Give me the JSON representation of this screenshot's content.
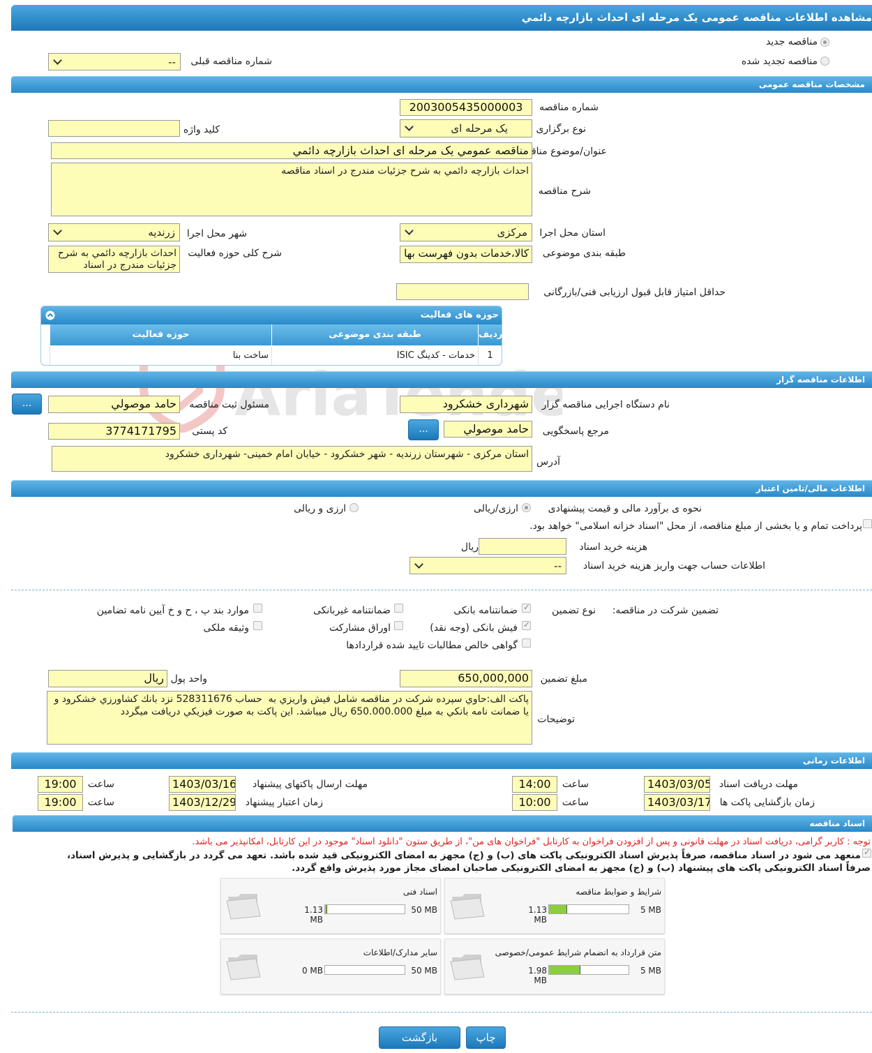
{
  "title": "مشاهده اطلاعات مناقصه عمومی یک مرحله ای احداث بازارچه دائمي",
  "radios": {
    "new": "مناقصه جدید",
    "renewed": "مناقصه تجدید شده",
    "prev_label": "شماره مناقصه قبلی",
    "prev_value": "--"
  },
  "sections": {
    "general": "مشخصات مناقصه عمومی",
    "organizer": "اطلاعات مناقصه گزار",
    "finance": "اطلاعات مالی/تامین اعتبار",
    "time": "اطلاعات زمانی",
    "docs": "اسناد مناقصه"
  },
  "general": {
    "number_label": "شماره مناقصه",
    "number": "2003005435000003",
    "type_label": "نوع برگزاری",
    "type": "یک مرحله ای",
    "keyword_label": "کلید واژه",
    "keyword": "",
    "subject_label": "عنوان/موضوع مناقصه",
    "subject": "مناقصه عمومي یک مرحله ای احداث بازارچه دائمي",
    "desc_label": "شرح مناقصه",
    "desc": "احداث بازارچه دائمي به شرح جزئيات مندرج در اسناد مناقصه",
    "province_label": "استان محل اجرا",
    "province": "مرکزی",
    "city_label": "شهر محل اجرا",
    "city": "زرندیه",
    "category_label": "طبقه بندی موضوعی",
    "category": "کالا،خدمات بدون فهرست بها",
    "scope_label": "شرح کلی حوزه فعالیت",
    "scope": "احداث بازارچه دائمي به شرح جزئيات مندرج در اسناد",
    "min_score_label": "حداقل امتیاز قابل قبول ارزیابی فنی/بازرگانی",
    "min_score": ""
  },
  "activity": {
    "title": "حوزه های فعالیت",
    "col_row": "ردیف",
    "col_cat": "طبقه بندی موضوعی",
    "col_area": "حوزه فعالیت",
    "rows": [
      {
        "row": "1",
        "cat": "خدمات - کدینگ ISIC",
        "area": "ساخت بنا"
      }
    ]
  },
  "organizer": {
    "org_label": "نام دستگاه اجرایی مناقصه گزار",
    "org": "شهرداری خشکرود",
    "registrar_label": "مسئول ثبت مناقصه",
    "registrar": "حامد موصولي",
    "ref_label": "مرجع پاسخگویی",
    "ref": "حامد موصولي",
    "postal_label": "کد پستی",
    "postal": "3774171795",
    "address_label": "آدرس",
    "address": "استان مرکزی - شهرستان زرندیه - شهر خشکرود - خیابان امام خمینی- شهرداری خشکرود",
    "more": "..."
  },
  "finance": {
    "method_label": "نحوه ی برآورد مالی و قیمت پیشنهادی",
    "opt1": "ارزی/ریالی",
    "opt2": "ارزی و ریالی",
    "treasury": "پرداخت تمام و یا بخشی از مبلغ مناقصه، از محل \"اسناد خزانه اسلامی\" خواهد بود.",
    "doc_cost_label": "هزینه خرید اسناد",
    "doc_cost": "",
    "rial": "ریال",
    "account_label": "اطلاعات حساب جهت واریز هزینه خرید اسناد",
    "account": "--"
  },
  "guarantee": {
    "label": "تضمین شرکت در مناقصه:",
    "type_label": "نوع تضمین",
    "bank": "ضمانتنامه بانکی",
    "nonbank": "ضمانتنامه غیربانکی",
    "items": "موارد بند پ ، ح و خ آیین نامه تضامین",
    "cash": "فیش بانکی (وجه نقد)",
    "bonds": "اوراق مشارکت",
    "property": "وثیقه ملکی",
    "claims": "گواهی خالص مطالبات تایید شده قراردادها",
    "amount_label": "مبلغ تضمین",
    "amount": "650,000,000",
    "currency_label": "واحد پول",
    "currency": "ریال",
    "notes_label": "توضیحات",
    "notes": "پاکت الف:حاوي سپرده شرکت در مناقصه شامل فيش واريزي به  حساب 528311676 نزد بانك كشاورزي خشكرود و يا ضمانت نامه بانكي به مبلغ 650.000.000 ريال ميباشد. اين پاكت به صورت فيزيكي دريافت ميگردد"
  },
  "time": {
    "doc_recv_label": "مهلت دریافت اسناد",
    "doc_recv_date": "1403/03/05",
    "doc_recv_time": "14:00",
    "send_label": "مهلت ارسال پاکتهای پیشنهاد",
    "send_date": "1403/03/16",
    "send_time": "19:00",
    "open_label": "زمان بازگشایی پاکت ها",
    "open_date": "1403/03/17",
    "open_time": "10:00",
    "valid_label": "زمان اعتبار پیشنهاد",
    "valid_date": "1403/12/29",
    "valid_time": "19:00",
    "hour": "ساعت"
  },
  "docs": {
    "notice": "توجه : کاربر گرامی، دریافت اسناد در مهلت قانونی و پس از افزودن فراخوان به کارتابل \"فراخوان های من\"، از طریق ستون \"دانلود اسناد\" موجود در این کارتابل، امکانپذیر می باشد.",
    "commit1": "منعهد می شود در اسناد مناقصه، صرفاً پذیرش اسناد الکترونیکی پاکت های (ب) و (ج) مجهز به امضای الکترونیکی قید شده باشد. تعهد می گردد در بازگشایی و پذیرش اسناد،",
    "commit2": "صرفاً اسناد الکترونیکی پاکت های پیشنهاد (ب) و (ج) مجهز به امضای الکترونیکی صاحبان امضای مجاز مورد پذیرش واقع گردد.",
    "cards": [
      {
        "title": "شرایط و ضوابط مناقصه",
        "cur": "1.13 MB",
        "max": "5 MB",
        "pct": 0.226
      },
      {
        "title": "اسناد فنی",
        "cur": "1.13 MB",
        "max": "50 MB",
        "pct": 0.0226
      },
      {
        "title": "متن قرارداد به انضمام شرایط عمومی/خصوصی",
        "cur": "1.98 MB",
        "max": "5 MB",
        "pct": 0.396
      },
      {
        "title": "سایر مدارک/اطلاعات",
        "cur": "0 MB",
        "max": "50 MB",
        "pct": 0
      }
    ]
  },
  "buttons": {
    "print": "چاپ",
    "back": "بازگشت"
  },
  "watermark": "AriaTender.neT"
}
